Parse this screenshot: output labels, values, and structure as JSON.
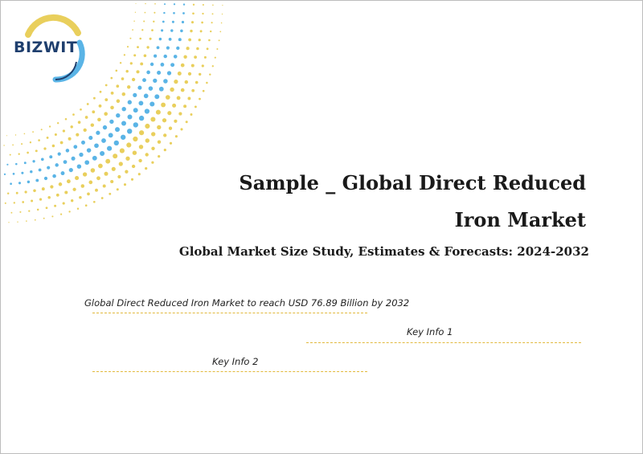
{
  "logo": {
    "text": "BIZWIT",
    "icon": "bizwit-logo"
  },
  "colors": {
    "dot_blue": "#5ab4e6",
    "dot_yellow": "#e9cf5c",
    "accent_line": "#e2b93d",
    "logo_navy": "#1f3f6e"
  },
  "report": {
    "title_line1": "Sample _ Global Direct Reduced",
    "title_line2": "Iron Market",
    "subtitle": "Global Market Size Study, Estimates & Forecasts: 2024-2032"
  },
  "key_info": {
    "headline": "Global Direct Reduced Iron Market to reach USD 76.89 Billion by 2032",
    "info1": "Key Info 1",
    "info2": "Key Info 2"
  }
}
